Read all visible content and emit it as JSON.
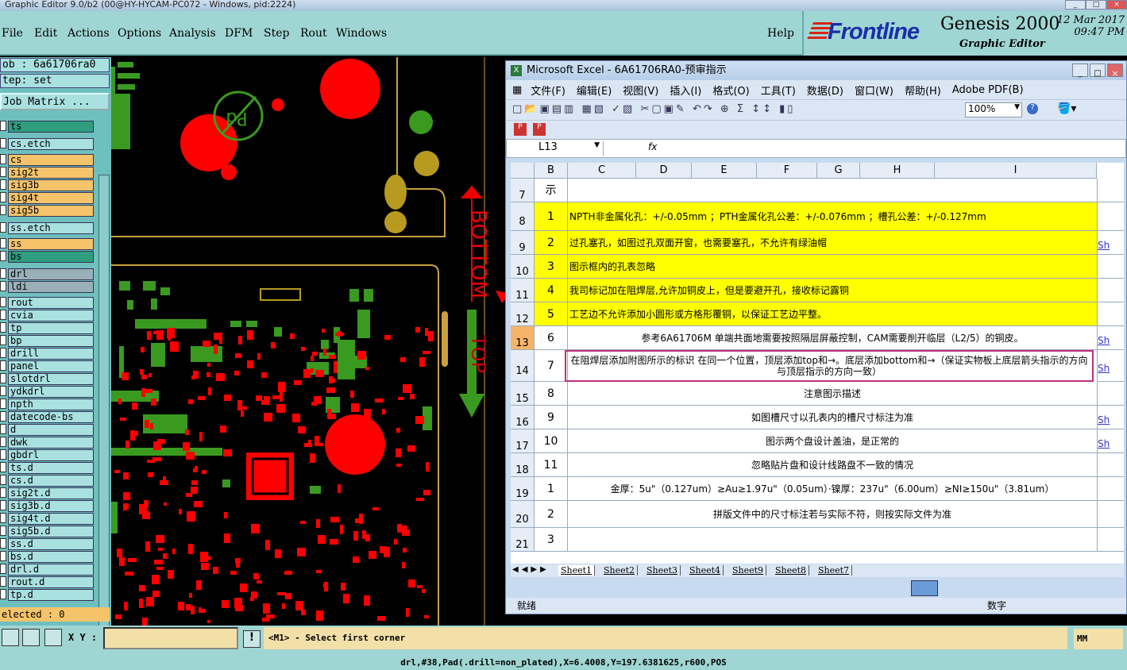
{
  "window_title": "Graphic Editor 9.0/b2 (00@HY-HYCAM-PC072 - Windows, pid:2224)",
  "menu": {
    "file": "File",
    "edit": "Edit",
    "actions": "Actions",
    "options": "Options",
    "analysis": "Analysis",
    "dfm": "DFM",
    "step": "Step",
    "rout": "Rout",
    "windows": "Windows",
    "help": "Help"
  },
  "brand": {
    "logo": "Frontline",
    "product": "Genesis 2000",
    "subtitle": "Graphic Editor",
    "date": "12 Mar 2017",
    "time": "09:47 PM"
  },
  "job": {
    "job_label": "ob : 6a61706ra0",
    "step_label": "tep: set",
    "matrix_button": "Job Matrix ..."
  },
  "layers": [
    {
      "name": "ts",
      "color": "#2e9e7e"
    },
    {
      "name": "cs.etch",
      "color": "#a9e0e0"
    },
    {
      "name": "cs",
      "color": "#f5c46a"
    },
    {
      "name": "sig2t",
      "color": "#f5c46a"
    },
    {
      "name": "sig3b",
      "color": "#f5c46a"
    },
    {
      "name": "sig4t",
      "color": "#f5c46a"
    },
    {
      "name": "sig5b",
      "color": "#f5c46a"
    },
    {
      "name": "ss.etch",
      "color": "#a9e0e0"
    },
    {
      "name": "ss",
      "color": "#f5c46a"
    },
    {
      "name": "bs",
      "color": "#2e9e7e"
    },
    {
      "name": "drl",
      "color": "#9ab0b8"
    },
    {
      "name": "ldi",
      "color": "#9ab0b8"
    },
    {
      "name": "rout",
      "color": "#a9e0e0"
    },
    {
      "name": "cvia",
      "color": "#a9e0e0"
    },
    {
      "name": "tp",
      "color": "#a9e0e0"
    },
    {
      "name": "bp",
      "color": "#a9e0e0"
    },
    {
      "name": "drill",
      "color": "#a9e0e0"
    },
    {
      "name": "panel",
      "color": "#a9e0e0"
    },
    {
      "name": "slotdrl",
      "color": "#a9e0e0"
    },
    {
      "name": "ydkdrl",
      "color": "#a9e0e0"
    },
    {
      "name": "npth",
      "color": "#a9e0e0"
    },
    {
      "name": "datecode-bs",
      "color": "#a9e0e0"
    },
    {
      "name": "d",
      "color": "#a9e0e0"
    },
    {
      "name": "dwk",
      "color": "#a9e0e0"
    },
    {
      "name": "gbdrl",
      "color": "#a9e0e0"
    },
    {
      "name": "ts.d",
      "color": "#a9e0e0"
    },
    {
      "name": "cs.d",
      "color": "#a9e0e0"
    },
    {
      "name": "sig2t.d",
      "color": "#a9e0e0"
    },
    {
      "name": "sig3b.d",
      "color": "#a9e0e0"
    },
    {
      "name": "sig4t.d",
      "color": "#a9e0e0"
    },
    {
      "name": "sig5b.d",
      "color": "#a9e0e0"
    },
    {
      "name": "ss.d",
      "color": "#a9e0e0"
    },
    {
      "name": "bs.d",
      "color": "#a9e0e0"
    },
    {
      "name": "drl.d",
      "color": "#a9e0e0"
    },
    {
      "name": "rout.d",
      "color": "#a9e0e0"
    },
    {
      "name": "tp.d",
      "color": "#a9e0e0"
    }
  ],
  "selected_label": "elected : 0",
  "canvas": {
    "bottom_text": "BOTTOM",
    "top_text": "TOP"
  },
  "excel": {
    "title": "Microsoft Excel - 6A61706RA0-预审指示",
    "menu": [
      "文件(F)",
      "编辑(E)",
      "视图(V)",
      "插入(I)",
      "格式(O)",
      "工具(T)",
      "数据(D)",
      "窗口(W)",
      "帮助(H)",
      "Adobe PDF(B)"
    ],
    "zoom": "100%",
    "name_box": "L13",
    "fx": "fx",
    "columns": [
      "B",
      "C",
      "D",
      "E",
      "F",
      "G",
      "H",
      "I"
    ],
    "rows": [
      {
        "row": "7",
        "num": "示",
        "text": "",
        "link": "",
        "hl": false
      },
      {
        "row": "8",
        "num": "1",
        "text": "NPTH非金属化孔：+/-0.05mm ；PTH金属化孔公差：+/-0.076mm ；槽孔公差：+/-0.127mm",
        "link": "",
        "hl": true
      },
      {
        "row": "9",
        "num": "2",
        "text": "过孔塞孔，如图过孔双面开窗，也需要塞孔，不允许有绿油帽",
        "link": "Sh",
        "hl": true
      },
      {
        "row": "10",
        "num": "3",
        "text": "图示框内的孔表忽略",
        "link": "",
        "hl": true
      },
      {
        "row": "11",
        "num": "4",
        "text": "我司标记加在阻焊层,允许加铜皮上，但是要避开孔，接收标记露铜",
        "link": "",
        "hl": true
      },
      {
        "row": "12",
        "num": "5",
        "text": "工艺边不允许添加小圆形或方格形覆铜，以保证工艺边平整。",
        "link": "",
        "hl": true
      },
      {
        "row": "13",
        "num": "6",
        "text": "参考6A61706M 单端共面地需要按照隔层屏蔽控制，CAM需要削开临层（L2/5）的铜皮。",
        "link": "Sh",
        "hl": false
      },
      {
        "row": "14",
        "num": "7",
        "text": "在阻焊层添加附图所示的标识  在同一个位置，顶层添加top和→。底层添加bottom和→（保证实物板上底层箭头指示的方向与顶层指示的方向一致）",
        "link": "Sh",
        "hl": false
      },
      {
        "row": "15",
        "num": "8",
        "text": "注意图示描述",
        "link": "",
        "hl": false
      },
      {
        "row": "16",
        "num": "9",
        "text": "如图槽尺寸以孔表内的槽尺寸标注为准",
        "link": "Sh",
        "hl": false
      },
      {
        "row": "17",
        "num": "10",
        "text": "图示两个盘设计盖油，是正常的",
        "link": "Sh",
        "hl": false
      },
      {
        "row": "18",
        "num": "11",
        "text": "忽略贴片盘和设计线路盘不一致的情况",
        "link": "",
        "hl": false
      },
      {
        "row": "19",
        "num": "1",
        "text": "金厚：5u\"（0.127um）≥Au≥1.97u\"（0.05um）·镍厚：237u\"（6.00um）≥NI≥150u\"（3.81um）",
        "link": "",
        "hl": false
      },
      {
        "row": "20",
        "num": "2",
        "text": "拼版文件中的尺寸标注若与实际不符，则按实际文件为准",
        "link": "",
        "hl": false
      },
      {
        "row": "21",
        "num": "3",
        "text": "",
        "link": "",
        "hl": false
      }
    ],
    "sheets": [
      "Sheet1",
      "Sheet2",
      "Sheet3",
      "Sheet4",
      "Sheet9",
      "Sheet8",
      "Sheet7"
    ],
    "status_ready": "就绪",
    "status_num": "数字"
  },
  "status": {
    "xy_label": "X Y :",
    "xy_value": "",
    "prompt": "<M1> - Select first corner",
    "units": "MM",
    "info": "drl,#38,Pad(.drill=non_plated),X=6.4008,Y=197.6381625,r600,POS"
  }
}
